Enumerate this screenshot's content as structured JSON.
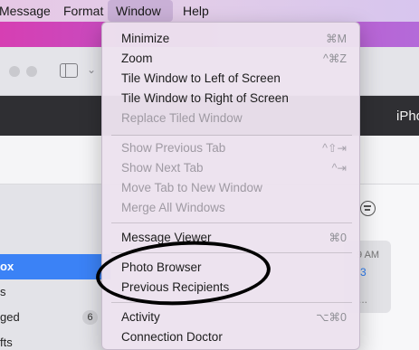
{
  "menubar": {
    "items": [
      {
        "label": "Message"
      },
      {
        "label": "Format"
      },
      {
        "label": "Window"
      },
      {
        "label": "Help"
      }
    ]
  },
  "background_app": {
    "header_text": "iPho",
    "sidebar": [
      {
        "label": "ox",
        "selected": true
      },
      {
        "label": "s"
      },
      {
        "label": "ged",
        "badge": "6"
      },
      {
        "label": "fts"
      }
    ],
    "card": {
      "time": "9 AM",
      "count": "3",
      "ellipsis": "..."
    }
  },
  "window_menu": {
    "groups": [
      [
        {
          "label": "Minimize",
          "shortcut": "⌘M",
          "enabled": true
        },
        {
          "label": "Zoom",
          "shortcut": "^⌘Z",
          "enabled": true
        },
        {
          "label": "Tile Window to Left of Screen",
          "shortcut": "",
          "enabled": true
        },
        {
          "label": "Tile Window to Right of Screen",
          "shortcut": "",
          "enabled": true
        },
        {
          "label": "Replace Tiled Window",
          "shortcut": "",
          "enabled": false
        }
      ],
      [
        {
          "label": "Show Previous Tab",
          "shortcut": "^⇧⇥",
          "enabled": false
        },
        {
          "label": "Show Next Tab",
          "shortcut": "^⇥",
          "enabled": false
        },
        {
          "label": "Move Tab to New Window",
          "shortcut": "",
          "enabled": false
        },
        {
          "label": "Merge All Windows",
          "shortcut": "",
          "enabled": false
        }
      ],
      [
        {
          "label": "Message Viewer",
          "shortcut": "⌘0",
          "enabled": true
        }
      ],
      [
        {
          "label": "Photo Browser",
          "shortcut": "",
          "enabled": true
        },
        {
          "label": "Previous Recipients",
          "shortcut": "",
          "enabled": true
        }
      ],
      [
        {
          "label": "Activity",
          "shortcut": "⌥⌘0",
          "enabled": true
        },
        {
          "label": "Connection Doctor",
          "shortcut": "",
          "enabled": true
        }
      ]
    ]
  }
}
